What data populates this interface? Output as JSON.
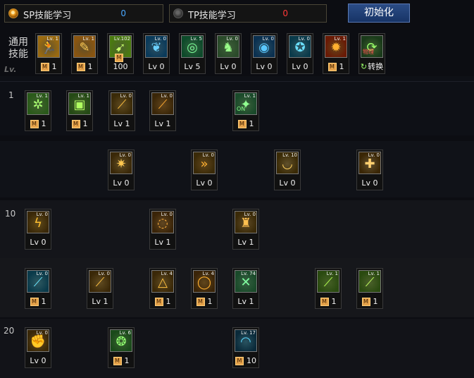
{
  "top": {
    "sp_label": "SP技能学习",
    "sp_value": "0",
    "tp_label": "TP技能学习",
    "tp_value": "0",
    "reset_label": "初始化"
  },
  "common_label": "通用技能",
  "watermark": "Lv.",
  "row_labels": [
    "1",
    "10",
    "20"
  ],
  "colors": {
    "sp_value": "#4aa8ff",
    "tp_value": "#ff3838",
    "accent": "#e5a24a"
  },
  "m_badge": "M",
  "common_skills": [
    {
      "icon_lv": "Lv. 1",
      "level": "1",
      "type": "m",
      "icon": "runner-icon",
      "bg": "#9a6a10",
      "fg": "#ffd76a"
    },
    {
      "icon_lv": "Lv. 1",
      "level": "1",
      "type": "m",
      "icon": "scroll-icon",
      "bg": "#8a5510",
      "fg": "#ffcc55"
    },
    {
      "icon_lv": "Lv.102",
      "level": "100",
      "type": "m",
      "icon": "sprint-icon",
      "bg": "#4a7a10",
      "fg": "#c8ff6a"
    },
    {
      "icon_lv": "Lv. 0",
      "level": "Lv 0",
      "type": "lv",
      "icon": "wings-icon",
      "bg": "#0a3a5a",
      "fg": "#6ad0ff"
    },
    {
      "icon_lv": "Lv. 5",
      "level": "Lv 5",
      "type": "lv",
      "icon": "target-icon",
      "bg": "#0d4a2a",
      "fg": "#7aff9a"
    },
    {
      "icon_lv": "Lv. 0",
      "level": "Lv 0",
      "type": "lv",
      "icon": "figure-icon",
      "bg": "#2a4a2a",
      "fg": "#9aff8a"
    },
    {
      "icon_lv": "Lv. 0",
      "level": "Lv 0",
      "type": "lv",
      "icon": "eye-icon",
      "bg": "#0a3050",
      "fg": "#5ac8ff"
    },
    {
      "icon_lv": "Lv. 0",
      "level": "Lv 0",
      "type": "lv",
      "icon": "body-icon",
      "bg": "#0a3a4a",
      "fg": "#6ae0ff"
    },
    {
      "icon_lv": "Lv. 1",
      "level": "1",
      "type": "m",
      "icon": "fire-icon",
      "bg": "#6a1a05",
      "fg": "#ffb030"
    },
    {
      "icon_lv": "",
      "level": "转换",
      "type": "conv",
      "icon": "convert-icon",
      "bg": "#1a3a1a",
      "fg": "#9aff6a",
      "overlay": "物理"
    }
  ],
  "skills": [
    {
      "icon_lv": "Lv. 1",
      "level": "1",
      "type": "m",
      "icon": "gear-skill-icon",
      "bg": "#2a5a1a",
      "fg": "#a8ff70"
    },
    {
      "icon_lv": "Lv. 1",
      "level": "1",
      "type": "m",
      "icon": "shield-skill-icon",
      "bg": "#254a15",
      "fg": "#b0ff60"
    },
    {
      "icon_lv": "Lv. 0",
      "level": "Lv 1",
      "type": "lv",
      "icon": "slash-icon",
      "bg": "#3a2a08",
      "fg": "#ffc040"
    },
    {
      "icon_lv": "Lv. 0",
      "level": "Lv 1",
      "type": "lv",
      "icon": "claw-icon",
      "bg": "#3a2608",
      "fg": "#ffaa30"
    },
    {
      "icon_lv": "Lv. 1",
      "level": "1",
      "type": "m",
      "icon": "stance-icon",
      "bg": "#1a4a2a",
      "fg": "#90ff90",
      "overlay": "ON"
    },
    {
      "icon_lv": "Lv. 0",
      "level": "Lv 0",
      "type": "lv",
      "icon": "burst-icon",
      "bg": "#3a2808",
      "fg": "#ffc850"
    },
    {
      "icon_lv": "Lv. 0",
      "level": "Lv 0",
      "type": "lv",
      "icon": "arrows-icon",
      "bg": "#3a2a08",
      "fg": "#ffb030"
    },
    {
      "icon_lv": "Lv. 10",
      "level": "Lv 0",
      "type": "lv",
      "icon": "wave-icon",
      "bg": "#3a2a05",
      "fg": "#ffd060"
    },
    {
      "icon_lv": "Lv. 0",
      "level": "Lv 0",
      "type": "lv",
      "icon": "guard-icon",
      "bg": "#3a2605",
      "fg": "#ffd070"
    },
    {
      "icon_lv": "Lv. 0",
      "level": "Lv 0",
      "type": "lv",
      "icon": "zigzag-icon",
      "bg": "#3a2808",
      "fg": "#ffc030"
    },
    {
      "icon_lv": "Lv. 0",
      "level": "Lv 1",
      "type": "lv",
      "icon": "spiral-icon",
      "bg": "#3a2408",
      "fg": "#ffb040"
    },
    {
      "icon_lv": "Lv. 0",
      "level": "Lv 1",
      "type": "lv",
      "icon": "dragon-icon",
      "bg": "#3a2a08",
      "fg": "#ffc050"
    },
    {
      "icon_lv": "Lv. 0",
      "level": "1",
      "type": "m",
      "icon": "sword-blue-icon",
      "bg": "#0a3a4a",
      "fg": "#6ae8ff"
    },
    {
      "icon_lv": "Lv. 0",
      "level": "Lv 1",
      "type": "lv",
      "icon": "blade-icon",
      "bg": "#3a2808",
      "fg": "#ffc040"
    },
    {
      "icon_lv": "Lv. 4",
      "level": "1",
      "type": "m",
      "icon": "triangle-icon",
      "bg": "#3a2808",
      "fg": "#ffc040"
    },
    {
      "icon_lv": "Lv. 4",
      "level": "1",
      "type": "m",
      "icon": "ring-icon",
      "bg": "#3a2408",
      "fg": "#ffb030"
    },
    {
      "icon_lv": "Lv. 74",
      "level": "Lv 1",
      "type": "lv",
      "icon": "cross-green-icon",
      "bg": "#1a4a2a",
      "fg": "#80ffa0"
    },
    {
      "icon_lv": "Lv. 1",
      "level": "1",
      "type": "m",
      "icon": "green-slash-icon",
      "bg": "#2a4a10",
      "fg": "#b0ff50"
    },
    {
      "icon_lv": "Lv. 1",
      "level": "1",
      "type": "m",
      "icon": "green-blade-icon",
      "bg": "#2a4a10",
      "fg": "#c0ff60"
    },
    {
      "icon_lv": "Lv. 0",
      "level": "Lv 0",
      "type": "lv",
      "icon": "fist-icon",
      "bg": "#3a2808",
      "fg": "#ffc040"
    },
    {
      "icon_lv": "Lv. 6",
      "level": "1",
      "type": "m",
      "icon": "beast-icon",
      "bg": "#1a4a1a",
      "fg": "#90ff70"
    },
    {
      "icon_lv": "Lv. 17",
      "level": "10",
      "type": "m",
      "icon": "arc-icon",
      "bg": "#0a2a3a",
      "fg": "#5ad8ff"
    }
  ]
}
